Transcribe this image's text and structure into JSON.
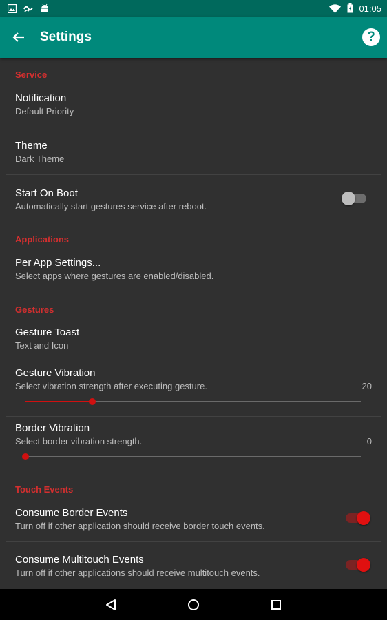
{
  "status_bar": {
    "time": "01:05",
    "left_icons": [
      "image-icon",
      "tasker-icon",
      "android-icon"
    ],
    "right_icons": [
      "wifi-icon",
      "battery-icon"
    ]
  },
  "app_bar": {
    "title": "Settings",
    "back_icon": "arrow-back-icon",
    "help_icon": "help-icon",
    "help_glyph": "?",
    "color": "#00897b"
  },
  "sections": {
    "service": {
      "header": "Service",
      "notification": {
        "title": "Notification",
        "summary": "Default Priority"
      },
      "theme": {
        "title": "Theme",
        "summary": "Dark Theme"
      },
      "start_on_boot": {
        "title": "Start On Boot",
        "summary": "Automatically start gestures service after reboot.",
        "enabled": false
      }
    },
    "applications": {
      "header": "Applications",
      "per_app": {
        "title": "Per App Settings...",
        "summary": "Select apps where gestures are enabled/disabled."
      }
    },
    "gestures": {
      "header": "Gestures",
      "gesture_toast": {
        "title": "Gesture Toast",
        "summary": "Text and Icon"
      },
      "gesture_vibration": {
        "title": "Gesture Vibration",
        "summary": "Select vibration strength after executing gesture.",
        "value": "20",
        "level": 0.2
      },
      "border_vibration": {
        "title": "Border Vibration",
        "summary": "Select border vibration strength.",
        "value": "0",
        "level": 0.0
      }
    },
    "touch_events": {
      "header": "Touch Events",
      "consume_border": {
        "title": "Consume Border Events",
        "summary": "Turn off if other application should receive border touch events.",
        "enabled": true
      },
      "consume_multitouch": {
        "title": "Consume Multitouch Events",
        "summary": "Turn off if other applications should receive multitouch events.",
        "enabled": true
      }
    }
  },
  "accent_color": "#d32f2f",
  "nav_bar": {
    "icons": [
      "back-triangle-icon",
      "home-circle-icon",
      "recents-square-icon"
    ]
  }
}
